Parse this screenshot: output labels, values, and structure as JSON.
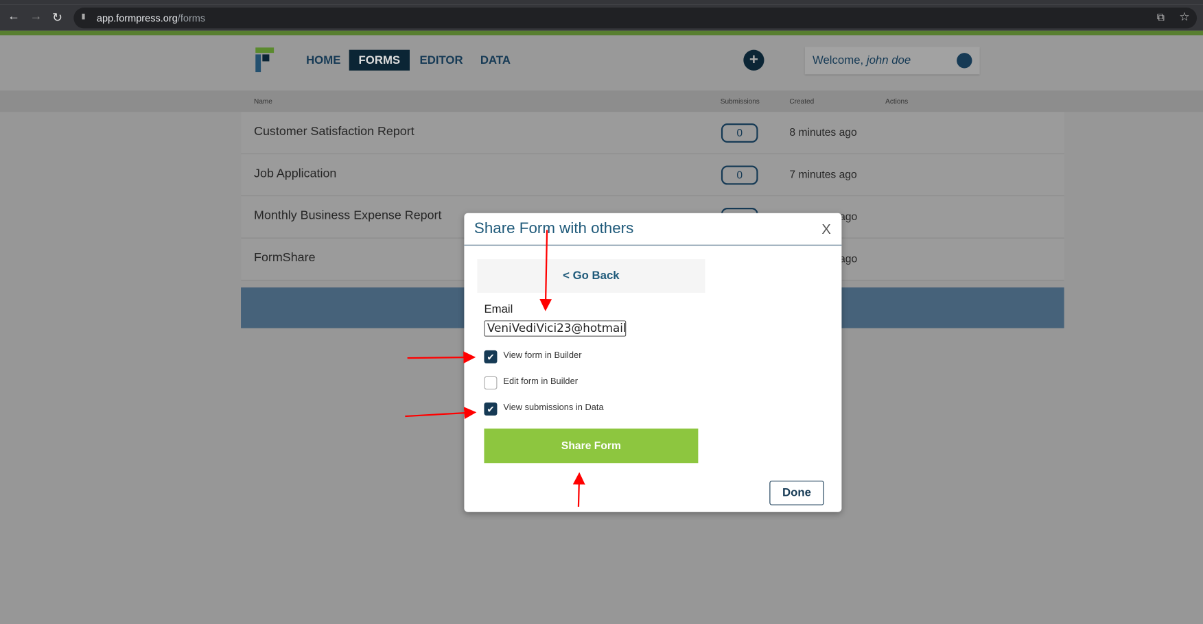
{
  "browser": {
    "url_host": "app.formpress.org",
    "url_path": "/forms",
    "back": "←",
    "forward": "→",
    "reload": "↻",
    "lock": "🔒",
    "translate": "⧉",
    "star": "☆"
  },
  "header": {
    "nav": [
      "HOME",
      "FORMS",
      "EDITOR",
      "DATA"
    ],
    "active": "FORMS",
    "add": "+",
    "welcome": "Welcome, ",
    "user": "john doe"
  },
  "table": {
    "columns": [
      "Name",
      "Submissions",
      "Created",
      "Actions"
    ],
    "rows": [
      {
        "name": "Customer Satisfaction Report",
        "submissions": "0",
        "created": "8 minutes ago"
      },
      {
        "name": "Job Application",
        "submissions": "0",
        "created": "7 minutes ago"
      },
      {
        "name": "Monthly Business Expense Report",
        "submissions": "",
        "created": "ago"
      },
      {
        "name": "FormShare",
        "submissions": "",
        "created": "ago"
      }
    ]
  },
  "modal": {
    "title": "Share Form with others",
    "close": "X",
    "go_back": "< Go Back",
    "email_label": "Email",
    "email_value": "VeniVediVici23@hotmail.",
    "permissions": [
      {
        "label": "View form in Builder",
        "checked": true
      },
      {
        "label": "Edit form in Builder",
        "checked": false
      },
      {
        "label": "View submissions in Data",
        "checked": true
      }
    ],
    "share": "Share Form",
    "done": "Done"
  },
  "colors": {
    "accent": "#8dc63f",
    "brand": "#163a55",
    "annotation": "#ff0000"
  }
}
